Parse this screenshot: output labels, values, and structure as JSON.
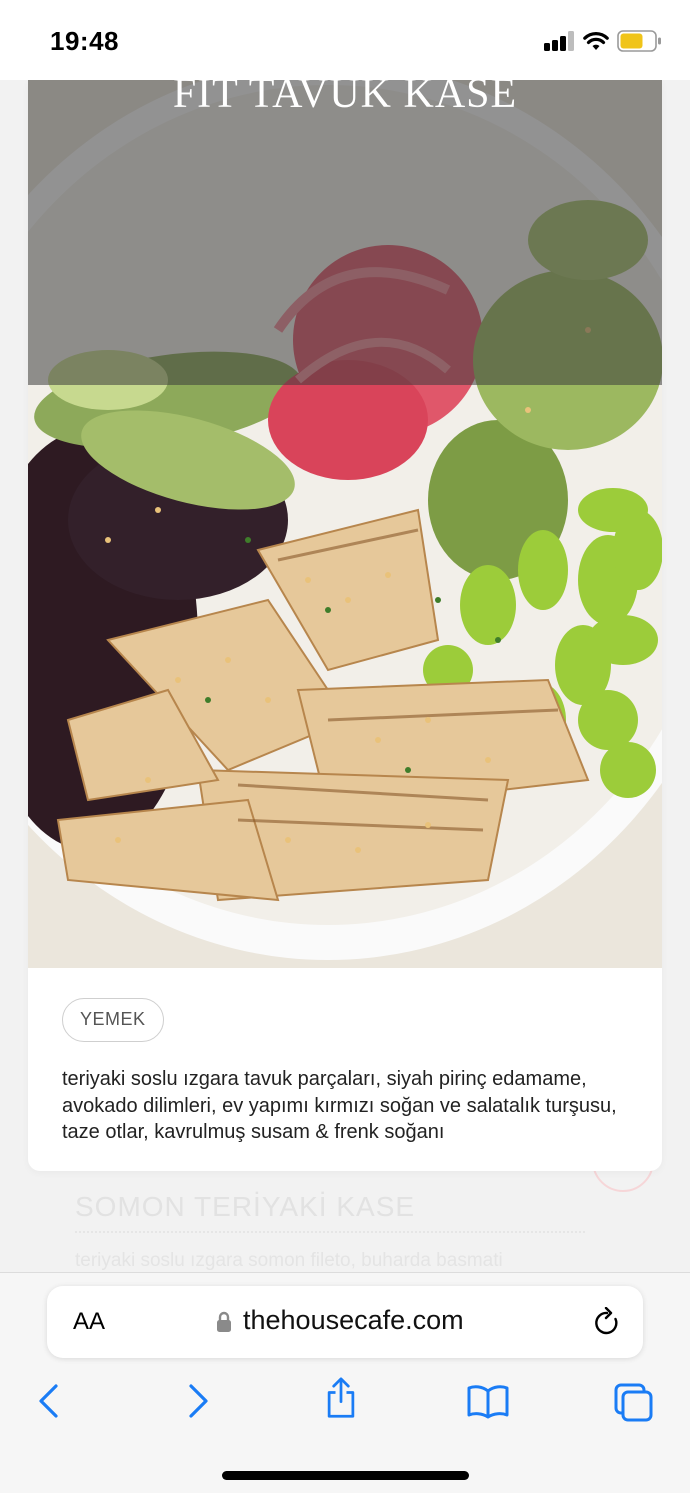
{
  "status_bar": {
    "time": "19:48"
  },
  "product": {
    "title": "FIT TAVUK KASE",
    "category": "YEMEK",
    "description": "teriyaki soslu ızgara tavuk parçaları, siyah pirinç edamame, avokado dilimleri, ev yapımı kırmızı soğan ve salatalık turşusu, taze otlar, kavrulmuş susam & frenk soğanı"
  },
  "next_product": {
    "title": "SOMON TERİYAKİ KASE",
    "description": "teriyaki soslu ızgara somon fileto, buharda basmati"
  },
  "browser": {
    "text_size_label": "AA",
    "url": "thehousecafe.com",
    "toolbar": [
      "back-icon",
      "forward-icon",
      "share-icon",
      "bookmarks-icon",
      "tabs-icon"
    ]
  },
  "colors": {
    "accent": "#1a7cf5",
    "chip_border": "#cfcfcf"
  }
}
